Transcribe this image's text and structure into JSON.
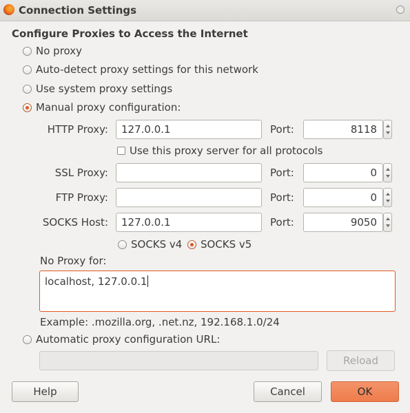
{
  "window": {
    "title": "Connection Settings"
  },
  "heading": "Configure Proxies to Access the Internet",
  "proxy_modes": {
    "no_proxy": "No proxy",
    "auto_detect": "Auto-detect proxy settings for this network",
    "system": "Use system proxy settings",
    "manual": "Manual proxy configuration:",
    "selected": "manual"
  },
  "manual": {
    "http": {
      "label": "HTTP Proxy:",
      "value": "127.0.0.1",
      "port_label": "Port:",
      "port": "8118"
    },
    "all_protocols": {
      "label": "Use this proxy server for all protocols",
      "checked": false
    },
    "ssl": {
      "label": "SSL Proxy:",
      "value": "",
      "port_label": "Port:",
      "port": "0"
    },
    "ftp": {
      "label": "FTP Proxy:",
      "value": "",
      "port_label": "Port:",
      "port": "0"
    },
    "socks": {
      "label": "SOCKS Host:",
      "value": "127.0.0.1",
      "port_label": "Port:",
      "port": "9050"
    },
    "socks_v4": "SOCKS v4",
    "socks_v5": "SOCKS v5",
    "socks_selected": "v5"
  },
  "no_proxy": {
    "label": "No Proxy for:",
    "value": "localhost, 127.0.0.1",
    "example": "Example: .mozilla.org, .net.nz, 192.168.1.0/24"
  },
  "auto_config": {
    "label": "Automatic proxy configuration URL:",
    "value": "",
    "reload_label": "Reload"
  },
  "buttons": {
    "help": "Help",
    "cancel": "Cancel",
    "ok": "OK"
  },
  "icons": {
    "app": "firefox-icon",
    "close": "close-icon"
  },
  "colors": {
    "accent": "#e1581f",
    "ok_button": "#ee7c4b"
  }
}
